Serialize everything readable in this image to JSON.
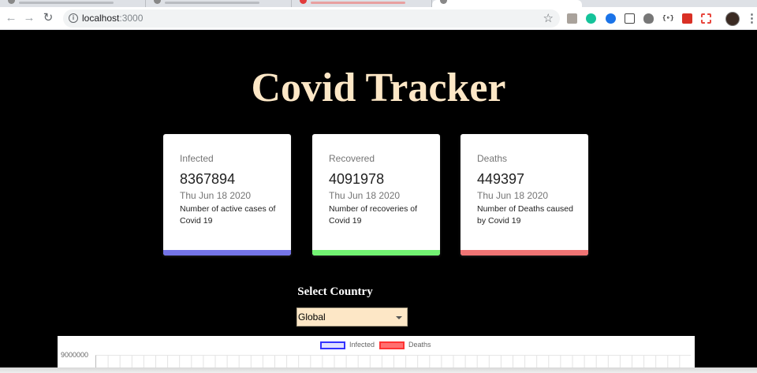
{
  "browser": {
    "url_host": "localhost",
    "url_port": ":3000"
  },
  "app": {
    "title": "Covid Tracker",
    "cards": [
      {
        "label": "Infected",
        "value": "8367894",
        "date": "Thu Jun 18 2020",
        "description": "Number of active cases of Covid 19",
        "color": "#7474e6"
      },
      {
        "label": "Recovered",
        "value": "4091978",
        "date": "Thu Jun 18 2020",
        "description": "Number of recoveries of Covid 19",
        "color": "#72f272"
      },
      {
        "label": "Deaths",
        "value": "449397",
        "date": "Thu Jun 18 2020",
        "description": "Number of Deaths caused by Covid 19",
        "color": "#ef7474"
      }
    ],
    "select_label": "Select Country",
    "country_select": {
      "selected": "Global"
    }
  },
  "chart_data": {
    "type": "line",
    "series": [
      {
        "name": "Infected",
        "color": "#3333ff"
      },
      {
        "name": "Deaths",
        "color": "#ff3333"
      }
    ],
    "y_ticks": [
      "9000000"
    ],
    "legend_position": "top"
  }
}
